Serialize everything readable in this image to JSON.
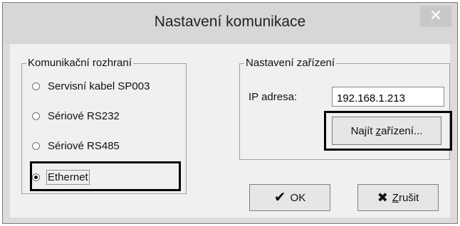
{
  "window": {
    "title": "Nastavení komunikace",
    "close_glyph": "✕"
  },
  "interface_group": {
    "legend": "Komunikační rozhraní",
    "options": [
      {
        "label": "Servisní kabel SP003",
        "selected": false
      },
      {
        "label": "Sériové RS232",
        "selected": false
      },
      {
        "label": "Sériové RS485",
        "selected": false
      },
      {
        "label": "Ethernet",
        "selected": true
      }
    ]
  },
  "device_group": {
    "legend": "Nastavení zařízení",
    "ip_label": "IP adresa:",
    "ip_value": "192.168.1.213",
    "find_button": {
      "prefix": "Najít ",
      "accel": "z",
      "suffix": "ařízení..."
    }
  },
  "buttons": {
    "ok_label": "OK",
    "ok_icon": "check-icon",
    "cancel_prefix": "",
    "cancel_accel": "Z",
    "cancel_suffix": "rušit",
    "cancel_icon": "cross-icon"
  }
}
